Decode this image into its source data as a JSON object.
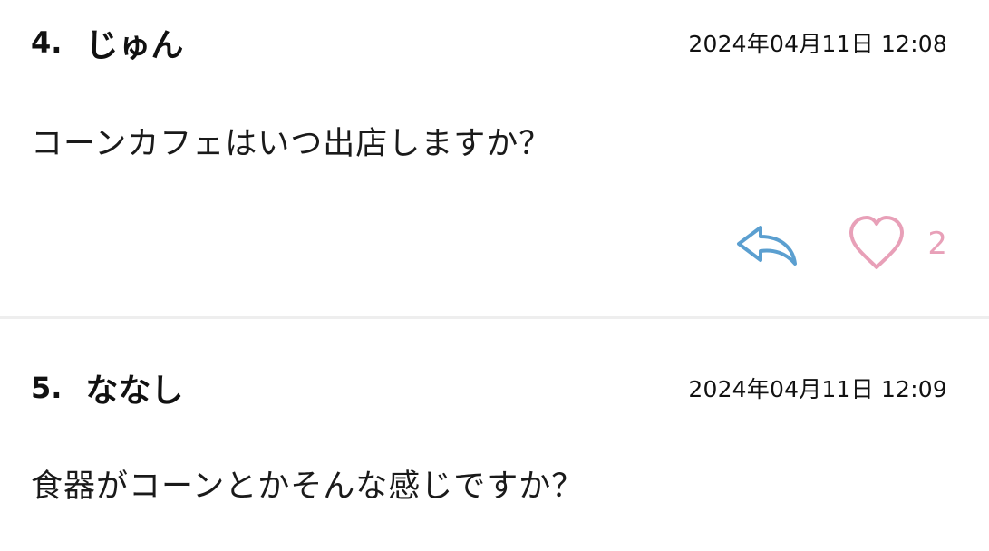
{
  "posts": [
    {
      "number": "4.",
      "author": "じゅん",
      "timestamp": "2024年04月11日 12:08",
      "body": "コーンカフェはいつ出店しますか？",
      "like_count": "2",
      "reply_icon": "reply-arrow-icon",
      "like_icon": "heart-icon"
    },
    {
      "number": "5.",
      "author": "ななし",
      "timestamp": "2024年04月11日 12:09",
      "body": "食器がコーンとかそんな感じですか？"
    }
  ],
  "colors": {
    "reply_icon": "#5b9fd0",
    "heart_icon": "#e8a0b8",
    "divider": "#eeeeee"
  }
}
